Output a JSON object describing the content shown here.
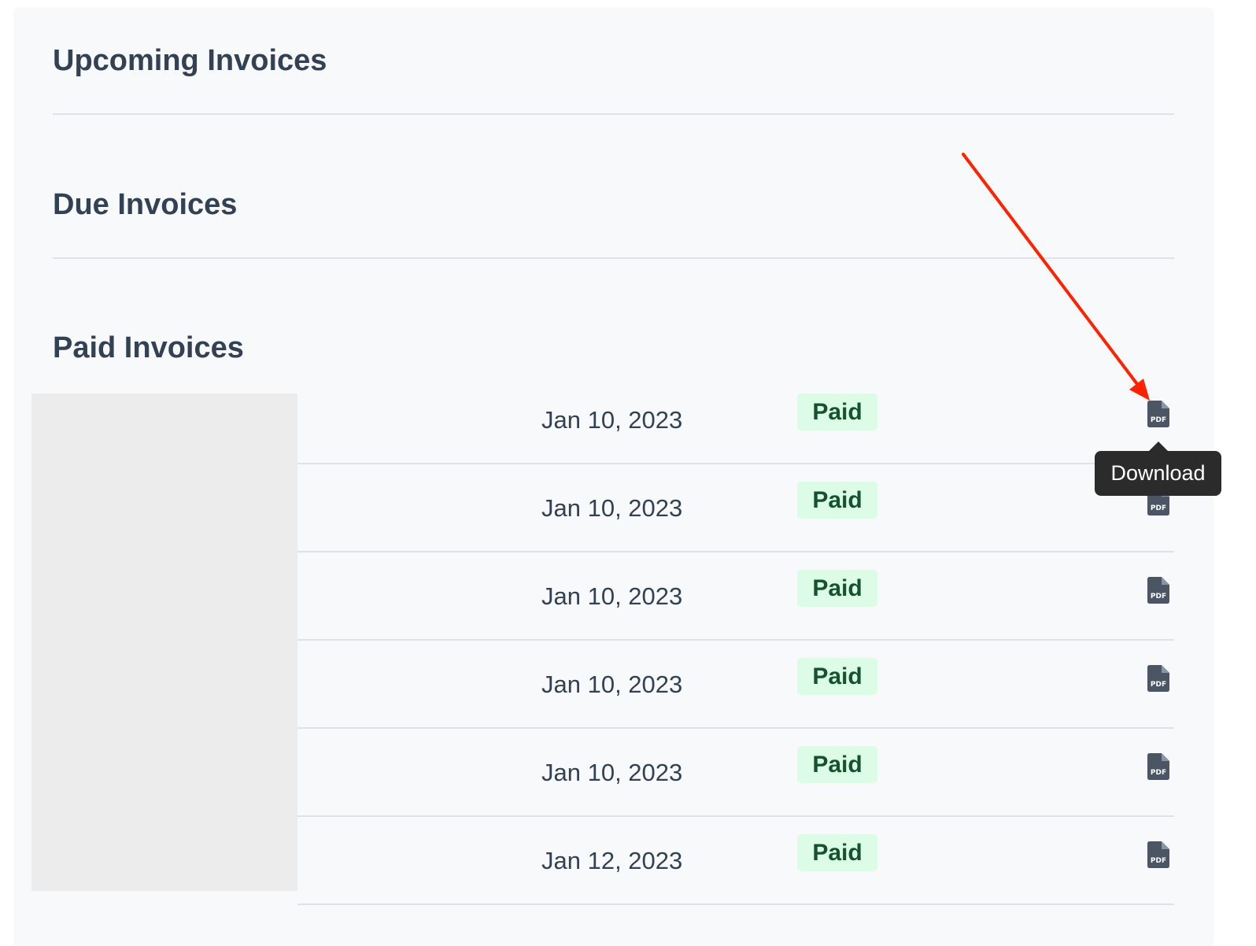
{
  "sections": {
    "upcoming_title": "Upcoming Invoices",
    "due_title": "Due Invoices",
    "paid_title": "Paid Invoices"
  },
  "paid_invoices": [
    {
      "date": "Jan 10, 2023",
      "status": "Paid",
      "action_icon": "pdf-file-icon"
    },
    {
      "date": "Jan 10, 2023",
      "status": "Paid",
      "action_icon": "pdf-file-icon"
    },
    {
      "date": "Jan 10, 2023",
      "status": "Paid",
      "action_icon": "pdf-file-icon"
    },
    {
      "date": "Jan 10, 2023",
      "status": "Paid",
      "action_icon": "pdf-file-icon"
    },
    {
      "date": "Jan 10, 2023",
      "status": "Paid",
      "action_icon": "pdf-file-icon"
    },
    {
      "date": "Jan 12, 2023",
      "status": "Paid",
      "action_icon": "pdf-file-icon"
    }
  ],
  "pdf_icon_text": "PDF",
  "tooltip": {
    "text": "Download"
  },
  "colors": {
    "badge_bg": "#dcfce7",
    "badge_text": "#14532d",
    "annotation_arrow": "#ff2200",
    "icon": "#4b5563"
  }
}
